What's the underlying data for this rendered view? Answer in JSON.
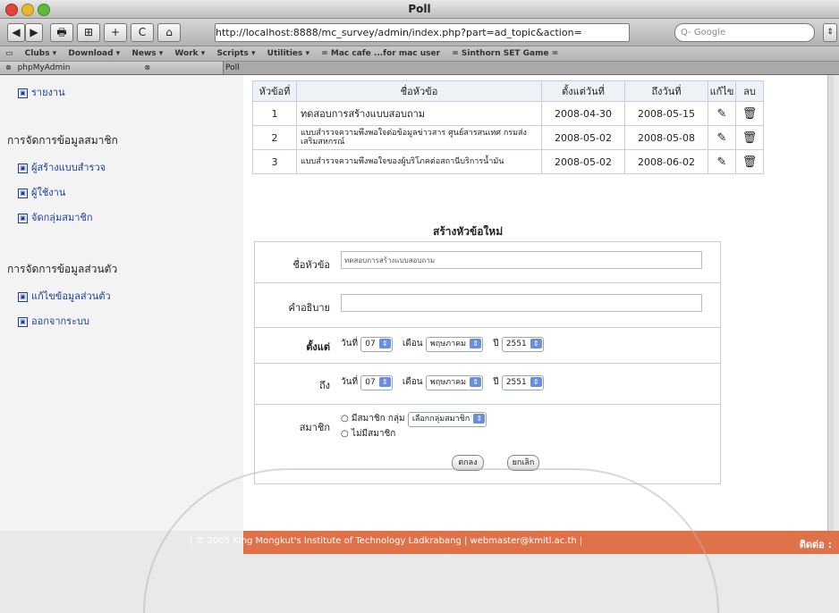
{
  "window": {
    "title": "Poll"
  },
  "toolbar": {
    "back": "◀",
    "forward": "▶",
    "print": "🖶",
    "view": "⊞",
    "add": "+",
    "reload": "C",
    "home": "⌂",
    "url": "http://localhost:8888/mc_survey/admin/index.php?part=ad_topic&action=",
    "search_placeholder": "Q- Google"
  },
  "bookmarks": [
    "Clubs ▾",
    "Download ▾",
    "News ▾",
    "Work ▾",
    "Scripts ▾",
    "Utilities ▾",
    "= Mac cafe ...for mac user",
    "= Sinthorn SET Game ="
  ],
  "tabs": {
    "active": "phpMyAdmin",
    "second": "Poll"
  },
  "sidebar": {
    "partial_item": "รายงาน",
    "section1": "การจัดการข้อมูลสมาชิก",
    "items1": [
      "ผู้สร้างแบบสำรวจ",
      "ผู้ใช้งาน",
      "จัดกลุ่มสมาชิก"
    ],
    "section2": "การจัดการข้อมูลส่วนตัว",
    "items2": [
      "แก้ไขข้อมูลส่วนตัว",
      "ออกจากระบบ"
    ]
  },
  "table": {
    "headers": [
      "หัวข้อที่",
      "ชื่อหัวข้อ",
      "ตั้งแต่วันที่",
      "ถึงวันที่",
      "แก้ไข",
      "ลบ"
    ],
    "rows": [
      {
        "num": "1",
        "title": "ทดสอบการสร้างแบบสอบถาม",
        "start": "2008-04-30",
        "end": "2008-05-15"
      },
      {
        "num": "2",
        "title": "แบบสำรวจความพึงพอใจต่อข้อมูลข่าวสาร ศูนย์สารสนเทศ กรมส่งเสริมสหกรณ์",
        "start": "2008-05-02",
        "end": "2008-05-08"
      },
      {
        "num": "3",
        "title": "แบบสำรวจความพึงพอใจของผู้บริโภคต่อสถานีบริการน้ำมัน",
        "start": "2008-05-02",
        "end": "2008-06-02"
      }
    ]
  },
  "form": {
    "title": "สร้างหัวข้อใหม่",
    "topic_label": "ชื่อหัวข้อ",
    "topic_value": "ทดสอบการสร้างแบบสอบถาม",
    "desc_label": "คำอธิบาย",
    "from_label": "ตั้งแต่",
    "to_label": "ถึง",
    "day_label": "วันที่",
    "month_label": "เดือน",
    "year_label": "ปี",
    "from_day": "07",
    "from_month": "พฤษภาคม",
    "from_year": "2551",
    "to_day": "07",
    "to_month": "พฤษภาคม",
    "to_year": "2551",
    "member_label": "สมาชิก",
    "member_opt1": "มีสมาชิก กลุ่ม",
    "member_group_select": "เลือกกลุ่มสมาชิก",
    "member_opt2": "ไม่มีสมาชิก",
    "submit": "ตกลง",
    "cancel": "ยกเลิก"
  },
  "footer": {
    "text": "| © 2005 King Mongkut's Institute of Technology Ladkrabang | webmaster@kmitl.ac.th |",
    "right": "ติดต่อ :"
  }
}
